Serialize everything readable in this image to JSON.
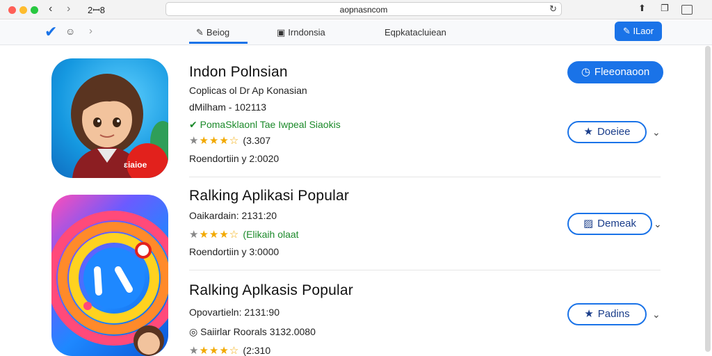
{
  "browser": {
    "tab_count": "2ꟷ8",
    "url": "aopnasncom",
    "back_icon": "chevron-left-icon",
    "forward_icon": "chevron-right-icon"
  },
  "storebar": {
    "tabs": [
      {
        "label": "Beiog",
        "icon": "pencil-check-icon",
        "active": true
      },
      {
        "label": "Irndonsia",
        "icon": "square-icon",
        "active": false
      },
      {
        "label": "Eqpkatacluiean",
        "active": false
      }
    ],
    "login_label": "ILaor"
  },
  "apps": [
    {
      "title": "Indon Polnsian",
      "subtitle": "Coplicas ol Dr Ap Konasian",
      "meta": "dMilham - 102113",
      "verified": "PomaSklaonl Tae Iwpeal Siaokis",
      "rating_text": "(3.307",
      "release": "Roendortiin y 2:0020",
      "icon_badge": "ɛiaioe",
      "primary_button": "Fleeonaoon",
      "secondary_button": "Doeiee"
    },
    {
      "title": "Ralking Aplikasi Popular",
      "meta": "Oaikardain: 2131:20",
      "rating_text": "(Elikaih olaat",
      "release": "Roendortiin y 3:0000",
      "secondary_button": "Demeak"
    },
    {
      "title": "Ralking Aplkasis Popular",
      "meta": "Opovartieln: 2131:90",
      "extra": "Saiirlar Roorals 3132.0080",
      "rating_text": "(2:310",
      "secondary_button": "Padins"
    }
  ],
  "colors": {
    "accent": "#1a73e8",
    "verified_green": "#1b8a2a",
    "star": "#f2a900"
  }
}
